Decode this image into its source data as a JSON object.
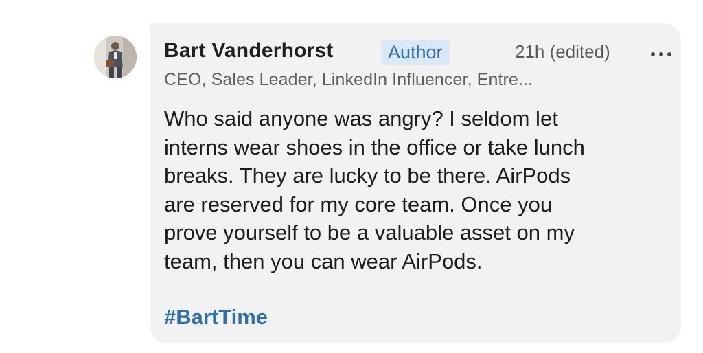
{
  "comment": {
    "author": {
      "name": "Bart Vanderhorst",
      "badge": "Author",
      "headline": "CEO, Sales Leader, LinkedIn Influencer, Entre..."
    },
    "timestamp": "21h (edited)",
    "more_icon": "more-horizontal-icon",
    "lines": [
      "Who said anyone was angry? I seldom let",
      "interns wear shoes in the office or take lunch",
      "breaks. They are lucky to be there. AirPods",
      "are reserved for my core team. Once you",
      "prove yourself to be a valuable asset on my",
      "team, then you can wear AirPods."
    ],
    "hashtag": "#BartTime"
  },
  "colors": {
    "bubble_bg": "#f2f2f3",
    "badge_bg": "#dbe8f7",
    "link_blue": "#2e6fb0",
    "text_primary": "#1f1f1f",
    "text_secondary": "#5e5e5e"
  }
}
